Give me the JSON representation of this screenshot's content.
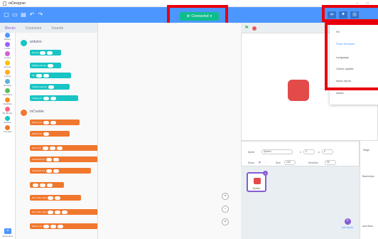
{
  "window": {
    "title": "mDesigner"
  },
  "toolbar": {
    "connect_label": "Connected"
  },
  "tabs": [
    {
      "label": "Blocks"
    },
    {
      "label": "Costumes"
    },
    {
      "label": "Sounds"
    }
  ],
  "categories": [
    {
      "label": "Motion",
      "color": "#4c97ff"
    },
    {
      "label": "Looks",
      "color": "#9966ff"
    },
    {
      "label": "Sound",
      "color": "#cf63cf"
    },
    {
      "label": "Events",
      "color": "#ffbf00"
    },
    {
      "label": "Control",
      "color": "#ffab19"
    },
    {
      "label": "Sensing",
      "color": "#5cb1d6"
    },
    {
      "label": "Operators",
      "color": "#59c059"
    },
    {
      "label": "Variables",
      "color": "#ff8c1a"
    },
    {
      "label": "My Blocks",
      "color": "#ff6680"
    },
    {
      "label": "arduino",
      "color": "#18c4c4"
    },
    {
      "label": "mCookie",
      "color": "#f0772e"
    }
  ],
  "extension_label": "Extensions",
  "palette": {
    "section1": "arduino",
    "section2": "mCookie",
    "arduino_blocks": [
      "Set pin",
      "Digital read pin",
      "Pin",
      "Analog read pin",
      "Analog pin"
    ],
    "mcookie_blocks": [
      "Motor pins",
      "Motor pins",
      "Servo pin",
      "ColorLED pin",
      "ColorLED pin",
      "",
      "Dot matrix addr",
      "Dot matrix addr",
      "Buzzer pin"
    ]
  },
  "menu": {
    "items": [
      {
        "label": "Kit"
      },
      {
        "label": "Flash firmware"
      },
      {
        "label": "Language"
      },
      {
        "label": "Check update"
      },
      {
        "label": "Issue report"
      },
      {
        "label": "About"
      }
    ]
  },
  "sprite_info": {
    "sprite_label": "Sprite",
    "sprite_name": "Sprite1",
    "x_label": "x",
    "x_value": "0",
    "y_label": "y",
    "y_value": "0",
    "show_label": "Show",
    "size_label": "Size",
    "size_value": "100",
    "direction_label": "Direction",
    "direction_value": "90"
  },
  "sprites": [
    {
      "name": "Sprite1"
    }
  ],
  "add_sprite_label": "Add Sprite",
  "stage_panel": {
    "label": "Stage",
    "backdrops_label": "Backdrops",
    "add_label": "Add Back"
  },
  "colors": {
    "brand": "#4c97ff",
    "accent": "#855cd6",
    "highlight": "#e8000b",
    "connected": "#0fbd8c"
  }
}
